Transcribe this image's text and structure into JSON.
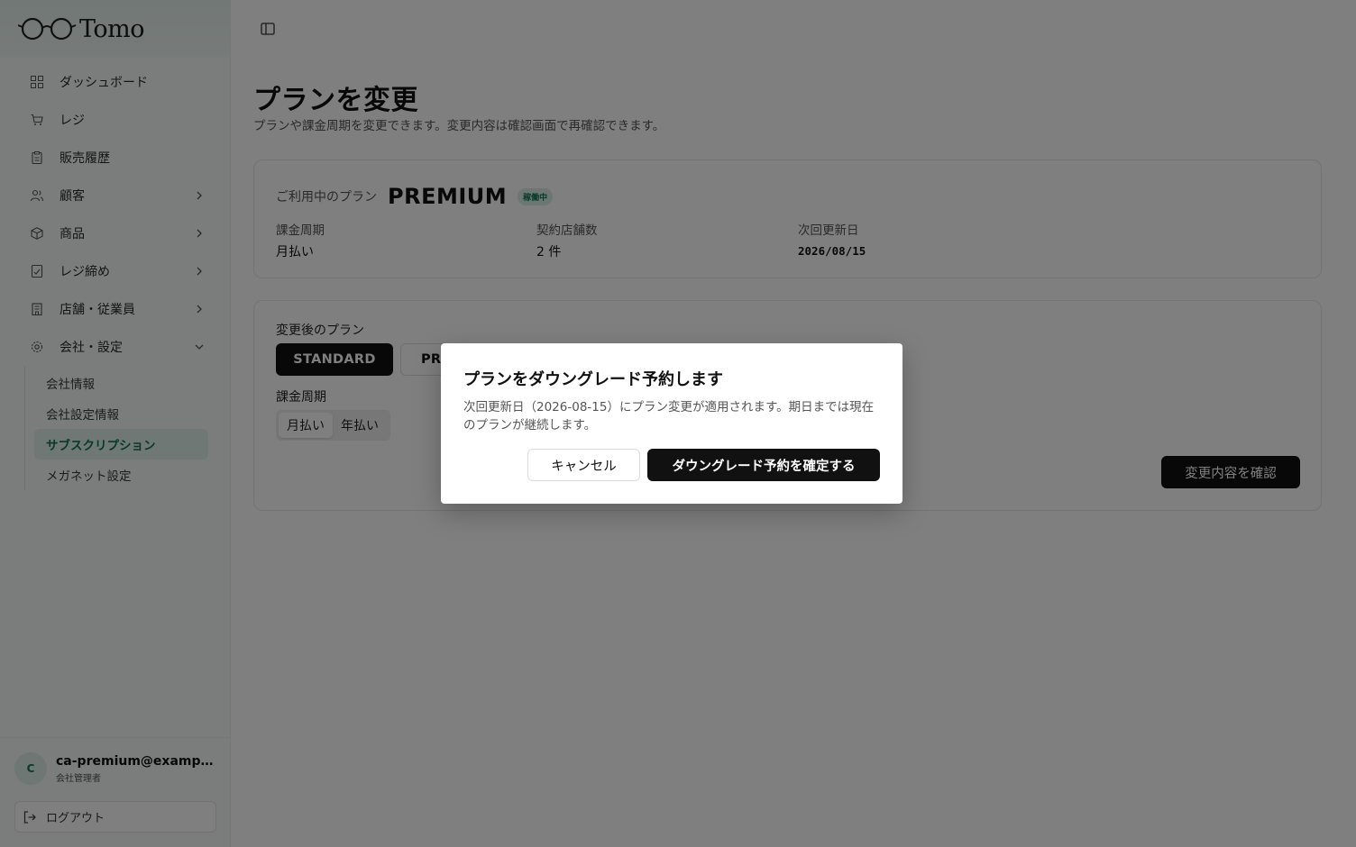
{
  "app": {
    "brand": "Tomo"
  },
  "sidebar": {
    "items": [
      {
        "label": "ダッシュボード",
        "icon": "dashboard-grid-icon"
      },
      {
        "label": "レジ",
        "icon": "cart-icon"
      },
      {
        "label": "販売履歴",
        "icon": "clipboard-icon"
      },
      {
        "label": "顧客",
        "icon": "users-icon"
      },
      {
        "label": "商品",
        "icon": "box-icon"
      },
      {
        "label": "レジ締め",
        "icon": "register-close-icon"
      },
      {
        "label": "店舗・従業員",
        "icon": "building-icon"
      },
      {
        "label": "会社・設定",
        "icon": "gear-icon"
      }
    ],
    "sub_items": [
      {
        "label": "会社情報"
      },
      {
        "label": "会社設定情報"
      },
      {
        "label": "サブスクリプション",
        "active": true
      },
      {
        "label": "メガネット設定"
      }
    ]
  },
  "user": {
    "avatar_initial": "C",
    "email": "ca-premium@example.com",
    "role": "会社管理者",
    "logout_label": "ログアウト"
  },
  "page": {
    "title": "プランを変更",
    "subtitle": "プランや課金周期を変更できます。変更内容は確認画面で再確認できます。"
  },
  "current_plan": {
    "label": "ご利用中のプラン",
    "plan": "PREMIUM",
    "status_badge": "稼働中",
    "billing_cycle_label": "課金周期",
    "billing_cycle_value": "月払い",
    "stores_label": "契約店舗数",
    "stores_value": "2 件",
    "next_renewal_label": "次回更新日",
    "next_renewal_value": "2026/08/15"
  },
  "change_form": {
    "new_plan_label": "変更後のプラン",
    "plan_options": [
      "STANDARD",
      "PREMIUM"
    ],
    "selected_plan": "STANDARD",
    "cycle_label": "課金周期",
    "cycle_options": [
      "月払い",
      "年払い"
    ],
    "selected_cycle": "月払い",
    "confirm_label": "変更内容を確認"
  },
  "dialog": {
    "title": "プランをダウングレード予約します",
    "description": "次回更新日（2026-08-15）にプラン変更が適用されます。期日までは現在のプランが継続します。",
    "cancel_label": "キャンセル",
    "confirm_label": "ダウングレード予約を確定する"
  },
  "colors": {
    "accent": "#137356",
    "accent_bg": "#dff1ea",
    "primary_button": "#111111",
    "overlay": "rgba(0,0,0,0.5)"
  }
}
